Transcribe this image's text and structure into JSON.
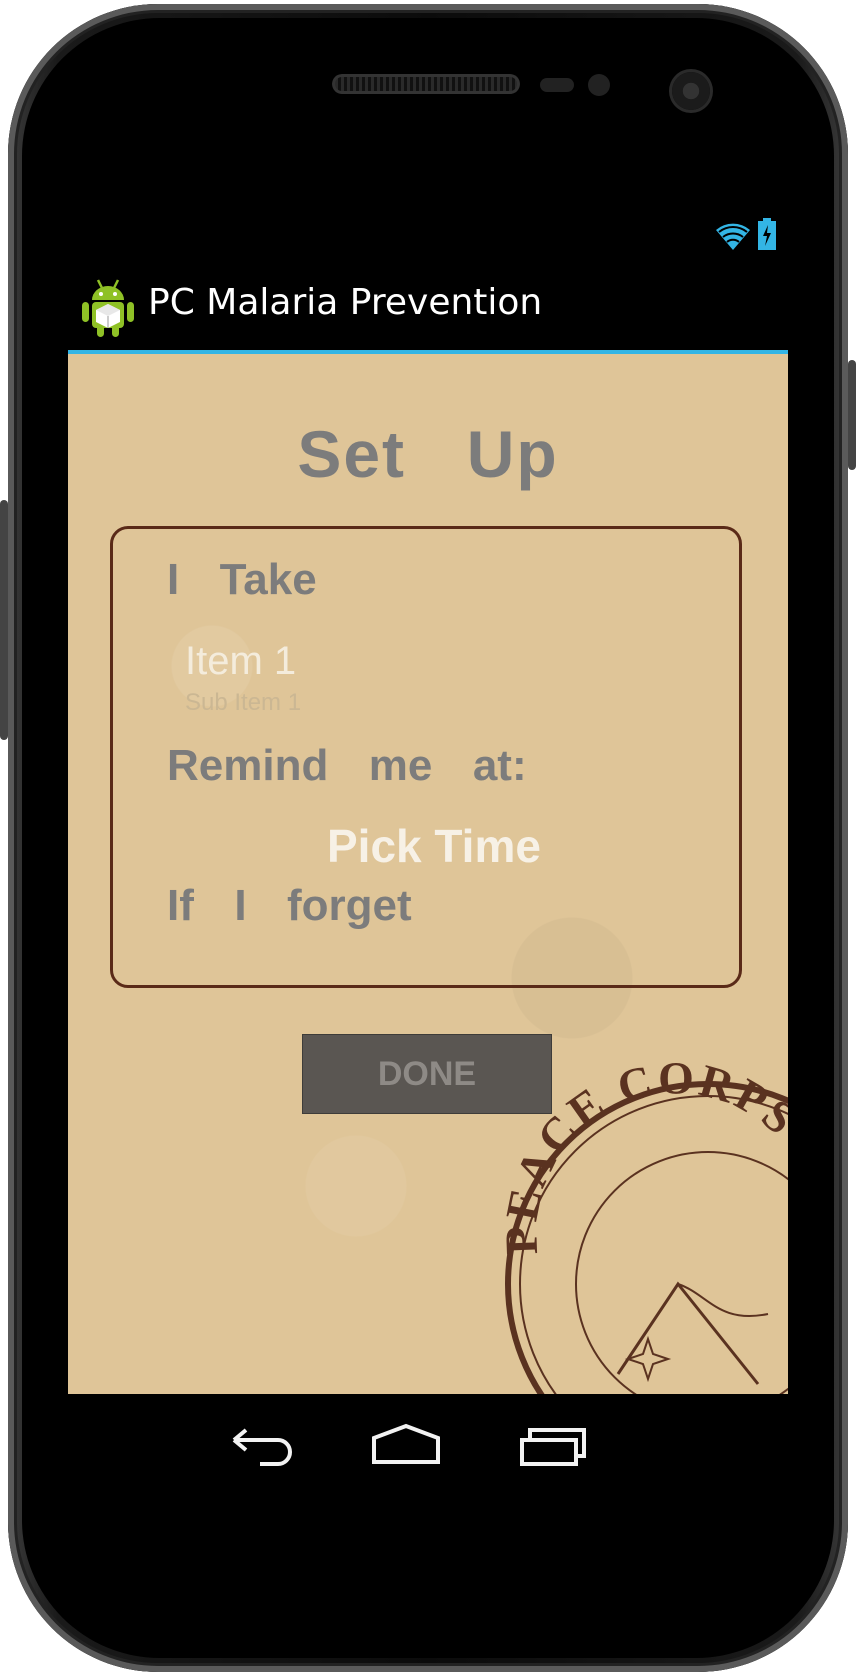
{
  "status_bar": {
    "wifi_icon": "wifi-icon",
    "battery_icon": "battery-charging-icon",
    "accent": "#33b5e5"
  },
  "action_bar": {
    "title": "PC Malaria Prevention",
    "app_icon": "android-icon"
  },
  "setup": {
    "title": "Set  Up",
    "take_label": "I  Take",
    "selected_item": {
      "title": "Item 1",
      "subtitle": "Sub Item 1"
    },
    "remind_label": "Remind  me  at:",
    "pick_time": "Pick Time",
    "forget_label": "If  I  forget",
    "done_button": "DONE"
  },
  "stamp": {
    "text": "PEACE CORPS"
  },
  "nav_bar": {
    "back_icon": "back-icon",
    "home_icon": "home-icon",
    "recents_icon": "recents-icon"
  }
}
